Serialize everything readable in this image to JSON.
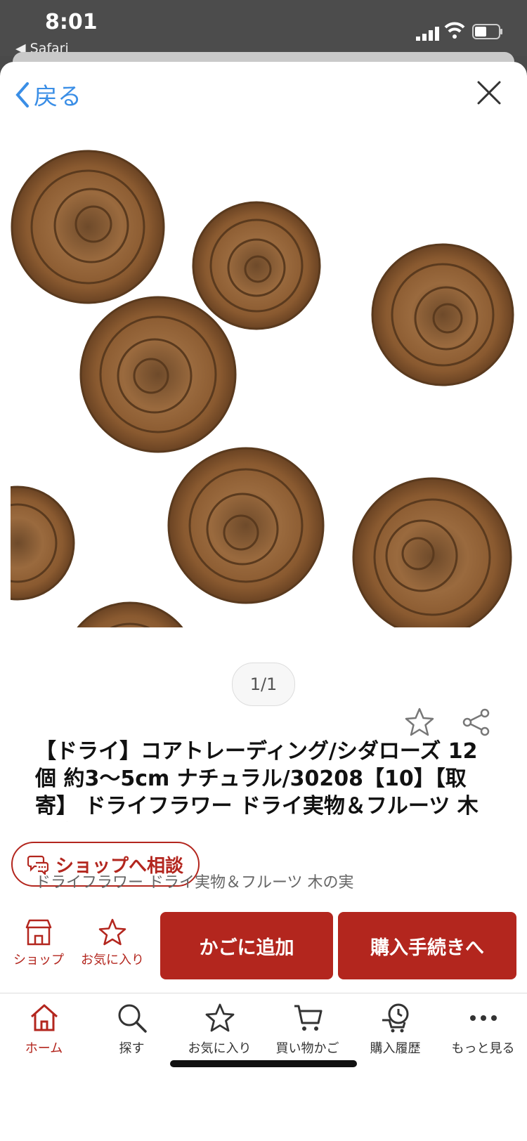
{
  "status": {
    "time": "8:01",
    "back_app": "◀ Safari"
  },
  "nav": {
    "back_label": "戻る"
  },
  "pager": {
    "text": "1/1"
  },
  "product": {
    "title": "【ドライ】コアトレーディング/シダローズ 12個 約3〜5cm ナチュラル/30208【10】【取寄】 ドライフラワー ドライ実物＆フルーツ 木の実",
    "category": "ドライフラワー ドライ実物＆フルーツ 木の実"
  },
  "consult": {
    "label": "ショップへ相談"
  },
  "actions": {
    "shop_label": "ショップ",
    "favorite_label": "お気に入り",
    "add_cart_label": "かごに追加",
    "checkout_label": "購入手続きへ"
  },
  "tabs": [
    {
      "label": "ホーム",
      "icon": "home-icon"
    },
    {
      "label": "探す",
      "icon": "search-icon"
    },
    {
      "label": "お気に入り",
      "icon": "star-icon"
    },
    {
      "label": "買い物かご",
      "icon": "cart-icon"
    },
    {
      "label": "購入履歴",
      "icon": "history-icon"
    },
    {
      "label": "もっと見る",
      "icon": "more-icon"
    }
  ],
  "colors": {
    "accent": "#b3261e",
    "link": "#3a8ee6"
  }
}
